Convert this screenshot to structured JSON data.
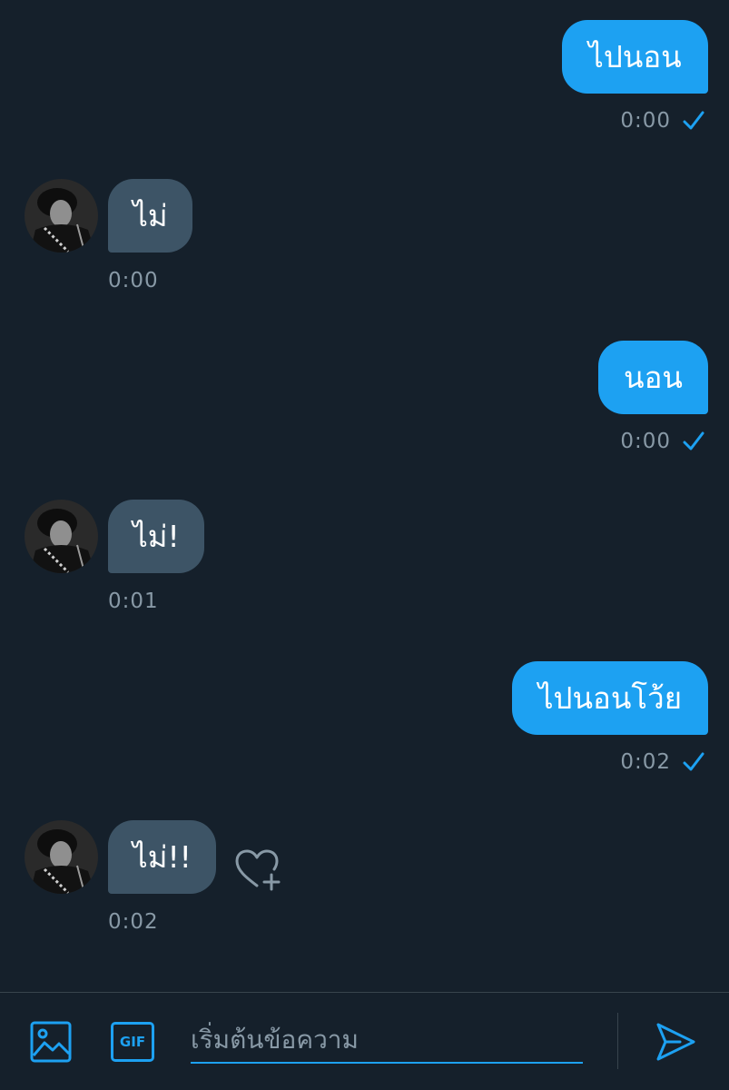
{
  "conversation": {
    "messages": [
      {
        "direction": "outgoing",
        "text": "ไปนอน",
        "time": "0:00"
      },
      {
        "direction": "incoming",
        "text": "ไม่",
        "time": "0:00"
      },
      {
        "direction": "outgoing",
        "text": "นอน",
        "time": "0:00"
      },
      {
        "direction": "incoming",
        "text": "ไม่!",
        "time": "0:01"
      },
      {
        "direction": "outgoing",
        "text": "ไปนอนโว้ย",
        "time": "0:02"
      },
      {
        "direction": "incoming",
        "text": "ไม่!!",
        "time": "0:02"
      }
    ]
  },
  "composer": {
    "placeholder": "เริ่มต้นข้อความ",
    "gif_label": "GIF"
  },
  "colors": {
    "background": "#15202b",
    "accent": "#1da1f2",
    "incoming_bubble": "#3d5466",
    "muted_text": "#8899a6"
  },
  "icons": {
    "read_receipt": "check-icon",
    "like": "heart-plus-icon",
    "media": "image-icon",
    "gif": "gif-icon",
    "send": "send-icon"
  }
}
